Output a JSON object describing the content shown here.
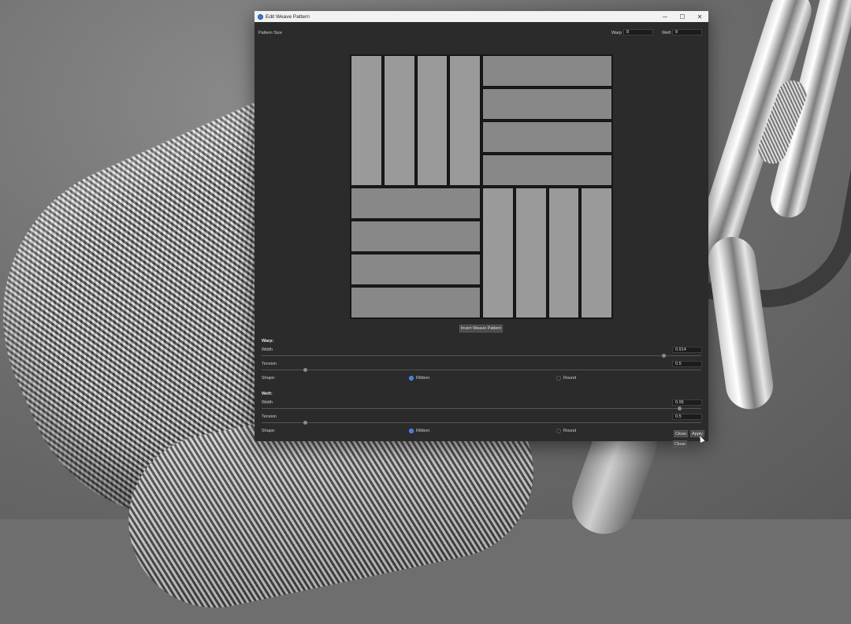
{
  "window": {
    "title": "Edit Weave Pattern",
    "minimize_glyph": "─",
    "maximize_glyph": "☐",
    "close_glyph": "✕"
  },
  "pattern_size": {
    "label": "Pattern Size",
    "warp_label": "Warp",
    "warp_value": "8",
    "weft_label": "Weft",
    "weft_value": "8"
  },
  "pattern_grid": {
    "rows": 8,
    "cols": 8,
    "blocks": [
      {
        "orientation": "vertical",
        "row": 0,
        "col": 0,
        "rows": 4,
        "cols": 4
      },
      {
        "orientation": "horizontal",
        "row": 0,
        "col": 4,
        "rows": 4,
        "cols": 4
      },
      {
        "orientation": "horizontal",
        "row": 4,
        "col": 0,
        "rows": 4,
        "cols": 4
      },
      {
        "orientation": "vertical",
        "row": 4,
        "col": 4,
        "rows": 4,
        "cols": 4
      }
    ]
  },
  "invert_button": "Invert Weave Pattern",
  "warp": {
    "heading": "Warp:",
    "width_label": "Width",
    "width_value": "0.914",
    "width_fraction": 0.914,
    "tension_label": "Tension",
    "tension_value": "0.5",
    "tension_fraction": 0.1,
    "shape_label": "Shape:",
    "shape_options": [
      "Ribbon",
      "Round"
    ],
    "shape_selected": "Ribbon"
  },
  "weft": {
    "heading": "Weft:",
    "width_label": "Width",
    "width_value": "0.95",
    "width_fraction": 0.95,
    "tension_label": "Tension",
    "tension_value": "0.5",
    "tension_fraction": 0.1,
    "shape_label": "Shape:",
    "shape_options": [
      "Ribbon",
      "Round"
    ],
    "shape_selected": "Ribbon"
  },
  "footer": {
    "close_label": "Close",
    "apply_label": "Apply"
  },
  "colors": {
    "accent": "#3c7ee0",
    "dialog_bg": "#2b2b2b"
  }
}
